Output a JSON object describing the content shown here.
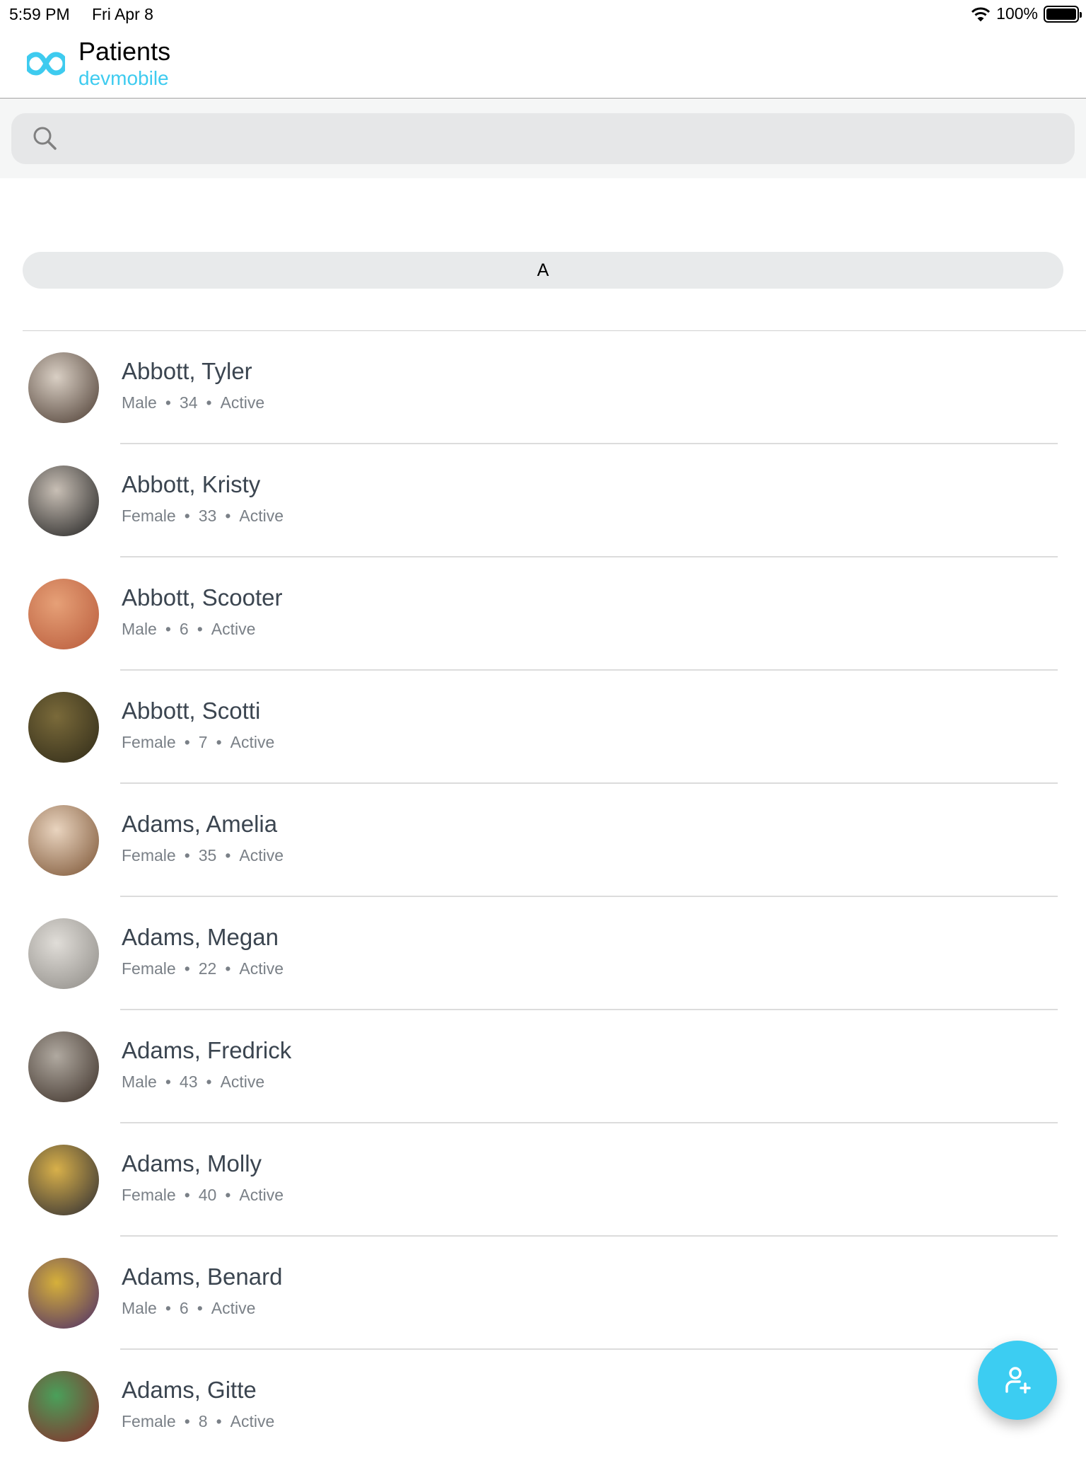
{
  "status_bar": {
    "time": "5:59 PM",
    "date": "Fri Apr 8",
    "battery": "100%",
    "battery_level": 100
  },
  "header": {
    "title": "Patients",
    "subtitle": "devmobile",
    "accent": "#3ecbef"
  },
  "search": {
    "placeholder": "",
    "value": ""
  },
  "section": {
    "letter": "A"
  },
  "patients": [
    {
      "name": "Abbott, Tyler",
      "gender": "Male",
      "age": "34",
      "status": "Active",
      "avatar": [
        "#d9cfc4",
        "#4a3a30"
      ]
    },
    {
      "name": "Abbott, Kristy",
      "gender": "Female",
      "age": "33",
      "status": "Active",
      "avatar": [
        "#c8bfb5",
        "#1f1f1f"
      ]
    },
    {
      "name": "Abbott, Scooter",
      "gender": "Male",
      "age": "6",
      "status": "Active",
      "avatar": [
        "#e6a077",
        "#b85a3a"
      ]
    },
    {
      "name": "Abbott, Scotti",
      "gender": "Female",
      "age": "7",
      "status": "Active",
      "avatar": [
        "#7a6a3a",
        "#2f2a18"
      ]
    },
    {
      "name": "Adams, Amelia",
      "gender": "Female",
      "age": "35",
      "status": "Active",
      "avatar": [
        "#e9d4bf",
        "#7a5232"
      ]
    },
    {
      "name": "Adams, Megan",
      "gender": "Female",
      "age": "22",
      "status": "Active",
      "avatar": [
        "#e0ddd8",
        "#8d8a85"
      ]
    },
    {
      "name": "Adams, Fredrick",
      "gender": "Male",
      "age": "43",
      "status": "Active",
      "avatar": [
        "#b0a9a0",
        "#3a2e26"
      ]
    },
    {
      "name": "Adams, Molly",
      "gender": "Female",
      "age": "40",
      "status": "Active",
      "avatar": [
        "#d8b04a",
        "#2a2a33"
      ]
    },
    {
      "name": "Adams, Benard",
      "gender": "Male",
      "age": "6",
      "status": "Active",
      "avatar": [
        "#d6b03a",
        "#4a2b6a"
      ]
    },
    {
      "name": "Adams, Gitte",
      "gender": "Female",
      "age": "8",
      "status": "Active",
      "avatar": [
        "#4aa05a",
        "#8a2a2a"
      ]
    }
  ],
  "fab": {
    "icon": "add-person-icon",
    "color": "#3ccdf2"
  }
}
